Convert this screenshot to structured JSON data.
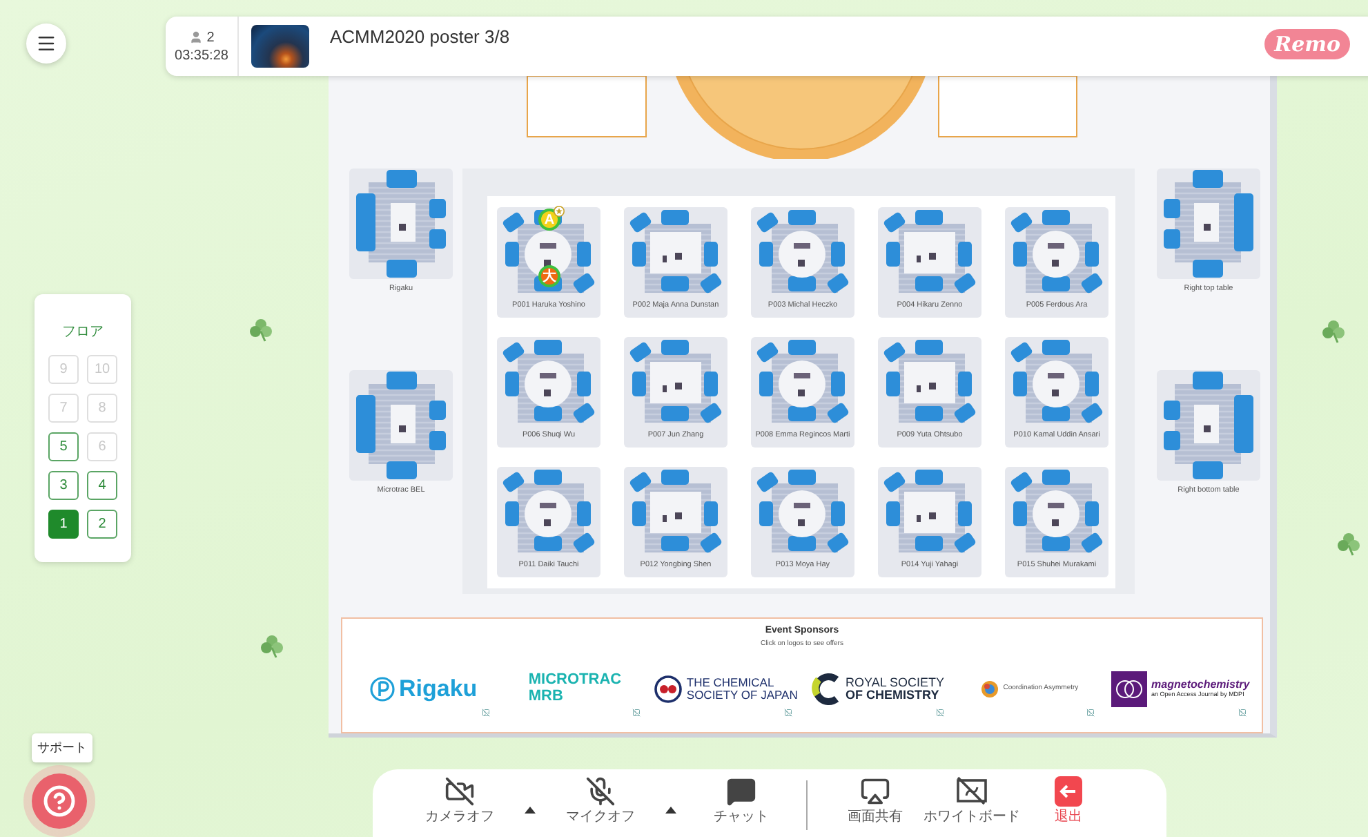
{
  "top_bar": {
    "participants": "2",
    "timer": "03:35:28",
    "title": "ACMM2020 poster 3/8",
    "logo": "Remo"
  },
  "floor_panel": {
    "title": "フロア",
    "floors": [
      {
        "label": "9",
        "selected": false,
        "disabled": true
      },
      {
        "label": "10",
        "selected": false,
        "disabled": true
      },
      {
        "label": "7",
        "selected": false,
        "disabled": true
      },
      {
        "label": "8",
        "selected": false,
        "disabled": true
      },
      {
        "label": "5",
        "selected": false,
        "disabled": false
      },
      {
        "label": "6",
        "selected": false,
        "disabled": true
      },
      {
        "label": "3",
        "selected": false,
        "disabled": false
      },
      {
        "label": "4",
        "selected": false,
        "disabled": false
      },
      {
        "label": "1",
        "selected": true,
        "disabled": false
      },
      {
        "label": "2",
        "selected": false,
        "disabled": false
      }
    ]
  },
  "left_tables": [
    {
      "label": "Rigaku"
    },
    {
      "label": "Microtrac BEL"
    }
  ],
  "right_tables": [
    {
      "label": "Right top table"
    },
    {
      "label": "Right bottom table"
    }
  ],
  "tables": [
    {
      "label": "P001 Haruka Yoshino",
      "kind": "round",
      "avatars": [
        {
          "initial": "A",
          "color": "#f2d21b",
          "starred": true
        },
        {
          "initial": "大",
          "color": "#ee6a12",
          "starred": false
        }
      ]
    },
    {
      "label": "P002 Maja Anna Dunstan",
      "kind": "rect"
    },
    {
      "label": "P003 Michal Heczko",
      "kind": "round"
    },
    {
      "label": "P004 Hikaru Zenno",
      "kind": "rect"
    },
    {
      "label": "P005 Ferdous Ara",
      "kind": "round"
    },
    {
      "label": "P006 Shuqi Wu",
      "kind": "round"
    },
    {
      "label": "P007 Jun Zhang",
      "kind": "rect"
    },
    {
      "label": "P008 Emma Regincos Marti",
      "kind": "round"
    },
    {
      "label": "P009 Yuta Ohtsubo",
      "kind": "rect"
    },
    {
      "label": "P010 Kamal Uddin Ansari",
      "kind": "round"
    },
    {
      "label": "P011 Daiki Tauchi",
      "kind": "round"
    },
    {
      "label": "P012 Yongbing Shen",
      "kind": "rect"
    },
    {
      "label": "P013 Moya Hay",
      "kind": "round"
    },
    {
      "label": "P014 Yuji Yahagi",
      "kind": "rect"
    },
    {
      "label": "P015 Shuhei Murakami",
      "kind": "round"
    }
  ],
  "sponsors": {
    "title": "Event Sponsors",
    "subtitle": "Click on logos to see offers",
    "logos": [
      {
        "kind": "rigaku",
        "lines": [
          "Rigaku"
        ]
      },
      {
        "kind": "microtrac",
        "lines": [
          "MICROTRAC",
          "MRB"
        ]
      },
      {
        "kind": "csj",
        "lines": [
          "THE CHEMICAL",
          "SOCIETY OF JAPAN"
        ]
      },
      {
        "kind": "rsc",
        "lines": [
          "ROYAL SOCIETY",
          "OF CHEMISTRY"
        ]
      },
      {
        "kind": "coordination",
        "lines": [
          "Coordination Asymmetry"
        ]
      },
      {
        "kind": "mdpi",
        "lines": [
          "magnetochemistry",
          "an Open Access Journal by MDPI"
        ]
      }
    ]
  },
  "toolbar": [
    {
      "kind": "camera-off",
      "label": "カメラオフ",
      "has_menu": true,
      "separator_before": false
    },
    {
      "kind": "mic-off",
      "label": "マイクオフ",
      "has_menu": true,
      "separator_before": false
    },
    {
      "kind": "chat",
      "label": "チャット",
      "has_menu": false,
      "separator_before": false
    },
    {
      "kind": "share",
      "label": "画面共有",
      "has_menu": false,
      "separator_before": true
    },
    {
      "kind": "whiteboard",
      "label": "ホワイトボード",
      "has_menu": false,
      "separator_before": false
    },
    {
      "kind": "exit",
      "label": "退出",
      "has_menu": false,
      "separator_before": false
    }
  ],
  "support": {
    "tooltip": "サポート"
  }
}
